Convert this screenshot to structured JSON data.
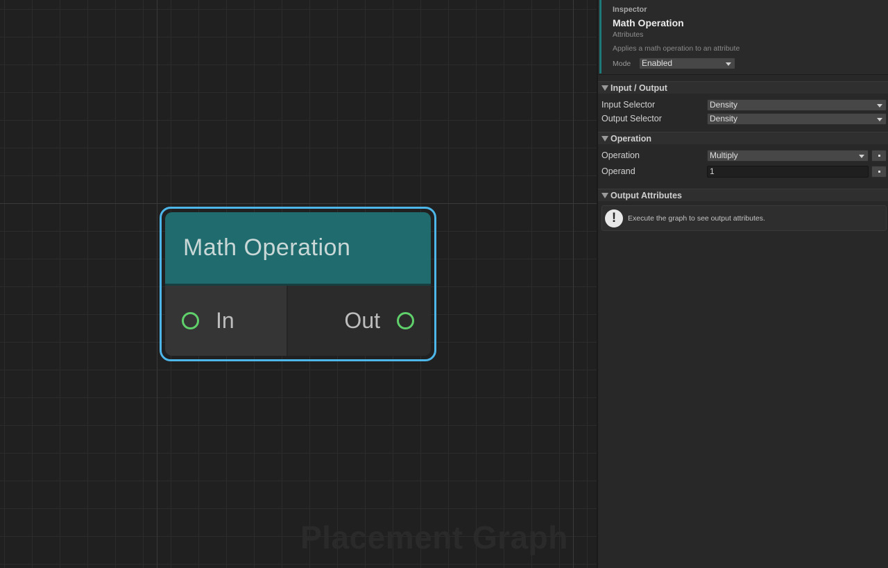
{
  "graph": {
    "watermark": "Placement Graph",
    "node": {
      "title": "Math Operation",
      "input_port": "In",
      "output_port": "Out"
    }
  },
  "inspector": {
    "header_label": "Inspector",
    "title": "Math Operation",
    "category": "Attributes",
    "description": "Applies a math operation to an attribute",
    "mode_label": "Mode",
    "mode_value": "Enabled",
    "sections": {
      "io": {
        "title": "Input / Output",
        "input_selector_label": "Input Selector",
        "input_selector_value": "Density",
        "output_selector_label": "Output Selector",
        "output_selector_value": "Density"
      },
      "operation": {
        "title": "Operation",
        "operation_label": "Operation",
        "operation_value": "Multiply",
        "operand_label": "Operand",
        "operand_value": "1"
      },
      "output_attributes": {
        "title": "Output Attributes",
        "help_icon": "!",
        "help_text": "Execute the graph to see output attributes."
      }
    }
  },
  "colors": {
    "node_header": "#1f6b6d",
    "selection_outline": "#4db7ea",
    "port": "#5fd06a",
    "inspector_accent": "#1e7a7a"
  }
}
